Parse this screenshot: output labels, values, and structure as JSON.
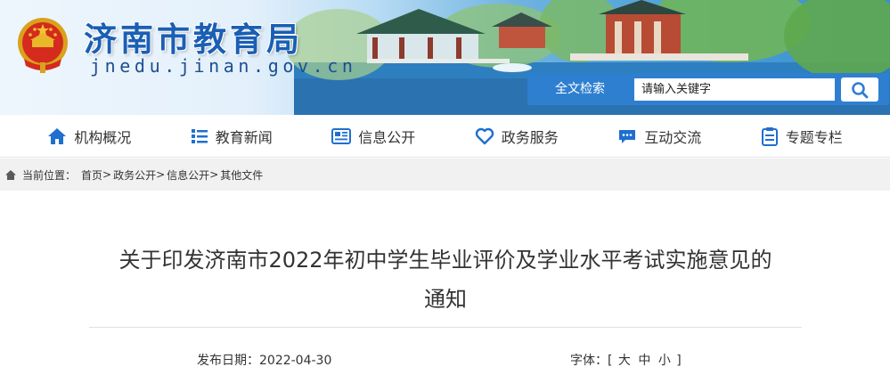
{
  "site": {
    "name": "济南市教育局",
    "domain": "jnedu.jinan.gov.cn"
  },
  "search": {
    "label": "全文检索",
    "placeholder": "请输入关键字"
  },
  "nav": {
    "items": [
      {
        "label": "机构概况",
        "icon": "home-icon"
      },
      {
        "label": "教育新闻",
        "icon": "list-icon"
      },
      {
        "label": "信息公开",
        "icon": "newspaper-icon"
      },
      {
        "label": "政务服务",
        "icon": "heart-icon"
      },
      {
        "label": "互动交流",
        "icon": "chat-icon"
      },
      {
        "label": "专题专栏",
        "icon": "clipboard-icon"
      }
    ]
  },
  "breadcrumb": {
    "label": "当前位置：",
    "items": [
      "首页",
      "政务公开",
      "信息公开",
      "其他文件"
    ],
    "separator": ">"
  },
  "article": {
    "title_line1": "关于印发济南市2022年初中学生毕业评价及学业水平考试实施意见的",
    "title_line2": "通知",
    "date_label": "发布日期：",
    "date": "2022-04-30",
    "font_label": "字体：[",
    "font_large": "大",
    "font_medium": "中",
    "font_small": "小",
    "font_close": "]"
  },
  "colors": {
    "brand_blue": "#1a5fb4",
    "nav_icon_blue": "#1f6fd0",
    "search_bg": "#2f7fd1"
  }
}
